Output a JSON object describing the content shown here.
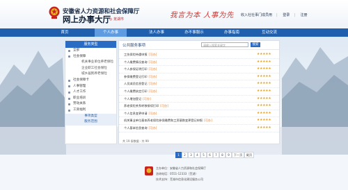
{
  "header": {
    "title_line1": "安徽省人力资源和社会保障厅",
    "title_line2": "网上办事大厅",
    "city": "◎ 芜湖市",
    "slogan": "我言为本 人事为先",
    "links": [
      "收入社社事门成员用",
      "登录",
      "注册"
    ]
  },
  "nav": {
    "items": [
      "首页",
      "个人办事",
      "法人办事",
      "办不事服示",
      "办事指南",
      "互动交流"
    ],
    "active_index": 1
  },
  "sidebar": {
    "header": "服务类型",
    "items": [
      {
        "label": "全部",
        "kind": "top"
      },
      {
        "label": "社会保障",
        "kind": "top"
      },
      {
        "label": "机关事业单位养老保险",
        "kind": "sub"
      },
      {
        "label": "企业职工社会保险",
        "kind": "sub"
      },
      {
        "label": "城乡居民养老保险",
        "kind": "sub"
      },
      {
        "label": "社会保障卡",
        "kind": "top"
      },
      {
        "label": "人事管理",
        "kind": "top"
      },
      {
        "label": "人才工作",
        "kind": "top"
      },
      {
        "label": "职业培训",
        "kind": "top"
      },
      {
        "label": "劳动关系",
        "kind": "top"
      },
      {
        "label": "工资福利",
        "kind": "top"
      },
      {
        "label": "事项类型",
        "kind": "blue"
      },
      {
        "label": "服务范围",
        "kind": "blue"
      }
    ]
  },
  "main": {
    "title": "公共服务事项",
    "search_placeholder": "请输入搜索关键字",
    "search_button": "搜索",
    "services": [
      {
        "name": "工伤保险待遇申报",
        "tag": "[可办]",
        "stars": "★★★★★"
      },
      {
        "name": "个人缴费情况查询",
        "tag": "[可办]",
        "stars": "★★★★★"
      },
      {
        "name": "个人参保证明打印",
        "tag": "[可办]",
        "stars": "★★★★★"
      },
      {
        "name": "参保缴费登记打印",
        "tag": "[可办]",
        "stars": "★★★★★"
      },
      {
        "name": "人员减员信息登记",
        "tag": "[可办]",
        "stars": "★★★★★"
      },
      {
        "name": "个人缴费核定打印",
        "tag": "[可办]",
        "stars": "★★★★★"
      },
      {
        "name": "个人增加登记",
        "tag": "[可办]",
        "stars": "★★★★★"
      },
      {
        "name": "养老保险关系转移接续打印",
        "tag": "[可办]",
        "stars": "★★★★★"
      },
      {
        "name": "个人信息变更申请",
        "tag": "[可办]",
        "stars": "★★★★★"
      },
      {
        "name": "机关事业单位基本养老保险参保缴费和工资基数变更登记申报",
        "tag": "[可办]",
        "stars": "★★★★★"
      },
      {
        "name": "个人基本信息查询",
        "tag": "[可办]",
        "stars": "★★★★★"
      }
    ],
    "total": "共 19 条数据 · 共 99"
  },
  "pagination": {
    "pages": [
      "1",
      "2",
      "3",
      "4",
      "5",
      "6",
      "7",
      "8",
      "9",
      "下一页",
      "尾页"
    ],
    "current": "1"
  },
  "footer": {
    "line1": "主办单位：安徽省人力资源和社会保障厅",
    "line2": "咨询电话：0551-12333（芜湖）",
    "line3": "技术支持：芜湖市信息化建设服务公司"
  },
  "colors": {
    "brand": "#1f5fad",
    "accent": "#d23a33",
    "star": "#e9a21b"
  }
}
